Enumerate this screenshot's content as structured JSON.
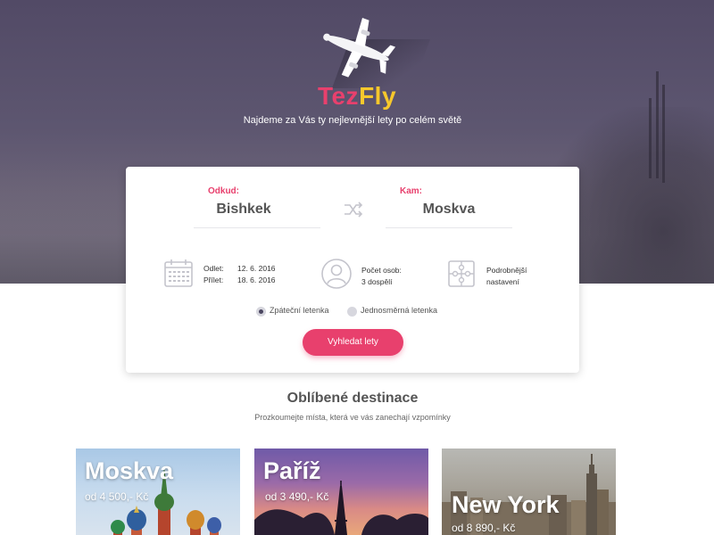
{
  "brand": {
    "part1": "Tez",
    "part2": "Fly"
  },
  "tagline": "Najdeme za Vás ty nejlevnější lety po celém světě",
  "search": {
    "from_label": "Odkud:",
    "from_value": "Bishkek",
    "to_label": "Kam:",
    "to_value": "Moskva",
    "departure_label": "Odlet:",
    "departure_date": "12. 6. 2016",
    "arrival_label": "Přílet:",
    "arrival_date": "18. 6. 2016",
    "persons_label": "Počet osob:",
    "persons_value": "3 dospělí",
    "settings_line1": "Podrobnější",
    "settings_line2": "nastavení",
    "return_ticket": "Zpáteční letenka",
    "oneway_ticket": "Jednosměrná letenka",
    "submit": "Vyhledat lety"
  },
  "destinations": {
    "title": "Oblíbené destinace",
    "subtitle": "Prozkoumejte místa, která ve vás zanechají vzpomínky",
    "items": [
      {
        "name": "Moskva",
        "price": "od 4 500,- Kč"
      },
      {
        "name": "Paříž",
        "price": "od 3 490,- Kč"
      },
      {
        "name": "New York",
        "price": "od 8 890,- Kč"
      }
    ]
  },
  "colors": {
    "accent": "#e8406d",
    "brand_yellow": "#f7c82c",
    "hero": "#5a5370"
  },
  "icons": [
    "airplane-icon",
    "swap-icon",
    "calendar-icon",
    "person-icon",
    "puzzle-icon"
  ]
}
